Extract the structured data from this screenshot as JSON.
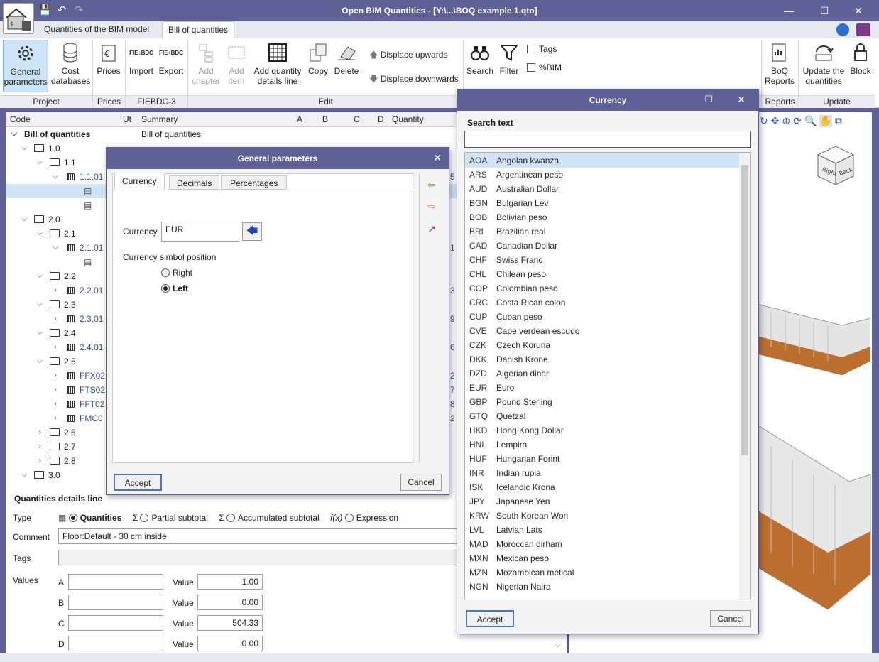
{
  "window": {
    "title": "Open BIM Quantities - [Y:\\...\\BOQ example 1.qto]"
  },
  "tabs": [
    "Quantities of the BIM model",
    "Bill of quantities"
  ],
  "ribbon": {
    "general_parameters": "General parameters",
    "cost_databases": "Cost databases",
    "prices": "Prices",
    "import": "Import",
    "export": "Export",
    "add_chapter": "Add chapter",
    "add_item": "Add item",
    "add_qty_line": "Add quantity details line",
    "copy": "Copy",
    "delete": "Delete",
    "displace_up": "Displace upwards",
    "displace_down": "Displace downwards",
    "search": "Search",
    "filter": "Filter",
    "tags": "Tags",
    "pct_bim": "%BIM",
    "boq_reports": "BoQ Reports",
    "update_quantities": "Update the quantities",
    "block": "Block",
    "groups": [
      "Project",
      "Prices",
      "FIEBDC-3",
      "Edit",
      "Reports",
      "Update"
    ],
    "fie": "FIE",
    "bdc": "BDC"
  },
  "tree": {
    "headers": [
      "Code",
      "Ut",
      "Summary",
      "A",
      "B",
      "C",
      "D",
      "Quantity"
    ],
    "root_code": "Bill of quantities",
    "root_summary": "Bill of quantities",
    "rows": [
      {
        "code": "1.0"
      },
      {
        "code": "1.1"
      },
      {
        "code": "1.1.01",
        "qty": "5"
      },
      {
        "code": ""
      },
      {
        "code": ""
      },
      {
        "code": "2.0"
      },
      {
        "code": "2.1"
      },
      {
        "code": "2.1.01",
        "qty": "1"
      },
      {
        "code": ""
      },
      {
        "code": "2.2"
      },
      {
        "code": "2.2.01",
        "qty": "3"
      },
      {
        "code": "2.3"
      },
      {
        "code": "2.3.01",
        "qty": "9"
      },
      {
        "code": "2.4"
      },
      {
        "code": "2.4.01",
        "qty": "6"
      },
      {
        "code": "2.5"
      },
      {
        "code": "FFX02",
        "qty": "2"
      },
      {
        "code": "FTS02",
        "qty": "7"
      },
      {
        "code": "FFT02",
        "qty": "8"
      },
      {
        "code": "FMC0",
        "qty": "2"
      },
      {
        "code": "2.6"
      },
      {
        "code": "2.7"
      },
      {
        "code": "2.8"
      },
      {
        "code": "3.0"
      }
    ]
  },
  "details": {
    "title": "Quantities details line",
    "type_label": "Type",
    "type_quantities": "Quantities",
    "type_partial": "Partial subtotal",
    "type_accum": "Accumulated subtotal",
    "type_expr": "Expression",
    "comment_label": "Comment",
    "comment_value": "Floor:Default - 30 cm inside",
    "tags_label": "Tags",
    "values_label": "Values",
    "value_label": "Value",
    "rows": [
      {
        "k": "A",
        "v": "1.00"
      },
      {
        "k": "B",
        "v": "0.00"
      },
      {
        "k": "C",
        "v": "504.33"
      },
      {
        "k": "D",
        "v": "0.00"
      }
    ]
  },
  "general_dialog": {
    "title": "General parameters",
    "tabs": [
      "Currency",
      "Decimals",
      "Percentages"
    ],
    "currency_label": "Currency",
    "currency_value": "EUR",
    "position_label": "Currency simbol position",
    "right": "Right",
    "left": "Left",
    "accept": "Accept",
    "cancel": "Cancel"
  },
  "currency_dialog": {
    "title": "Currency",
    "search_label": "Search text",
    "search_value": "",
    "accept": "Accept",
    "cancel": "Cancel",
    "items": [
      {
        "c": "AOA",
        "n": "Angolan kwanza"
      },
      {
        "c": "ARS",
        "n": "Argentinean peso"
      },
      {
        "c": "AUD",
        "n": "Australian Dollar"
      },
      {
        "c": "BGN",
        "n": "Bulgarian Lev"
      },
      {
        "c": "BOB",
        "n": "Bolivian peso"
      },
      {
        "c": "BRL",
        "n": "Brazilian real"
      },
      {
        "c": "CAD",
        "n": "Canadian Dollar"
      },
      {
        "c": "CHF",
        "n": "Swiss Franc"
      },
      {
        "c": "CHL",
        "n": "Chilean peso"
      },
      {
        "c": "COP",
        "n": "Colombian peso"
      },
      {
        "c": "CRC",
        "n": "Costa Rican colon"
      },
      {
        "c": "CUP",
        "n": "Cuban peso"
      },
      {
        "c": "CVE",
        "n": "Cape verdean escudo"
      },
      {
        "c": "CZK",
        "n": "Czech Koruna"
      },
      {
        "c": "DKK",
        "n": "Danish Krone"
      },
      {
        "c": "DZD",
        "n": "Algerian dinar"
      },
      {
        "c": "EUR",
        "n": "Euro"
      },
      {
        "c": "GBP",
        "n": "Pound Sterling"
      },
      {
        "c": "GTQ",
        "n": "Quetzal"
      },
      {
        "c": "HKD",
        "n": "Hong Kong Dollar"
      },
      {
        "c": "HNL",
        "n": "Lempira"
      },
      {
        "c": "HUF",
        "n": "Hungarian Forint"
      },
      {
        "c": "INR",
        "n": "Indian rupia"
      },
      {
        "c": "ISK",
        "n": "Icelandic Krona"
      },
      {
        "c": "JPY",
        "n": "Japanese Yen"
      },
      {
        "c": "KRW",
        "n": "South Korean Won"
      },
      {
        "c": "LVL",
        "n": "Latvian Lats"
      },
      {
        "c": "MAD",
        "n": "Moroccan dirham"
      },
      {
        "c": "MXN",
        "n": "Mexican peso"
      },
      {
        "c": "MZN",
        "n": "Mozambican metical"
      },
      {
        "c": "NGN",
        "n": "Nigerian Naira"
      }
    ]
  },
  "viewcube": {
    "right": "Right",
    "back": "Back"
  },
  "colors": {
    "title_bar": "#5d6196",
    "selection": "#cfe3f7",
    "link": "#2a4fa0",
    "model_orange": "#b8621b"
  }
}
